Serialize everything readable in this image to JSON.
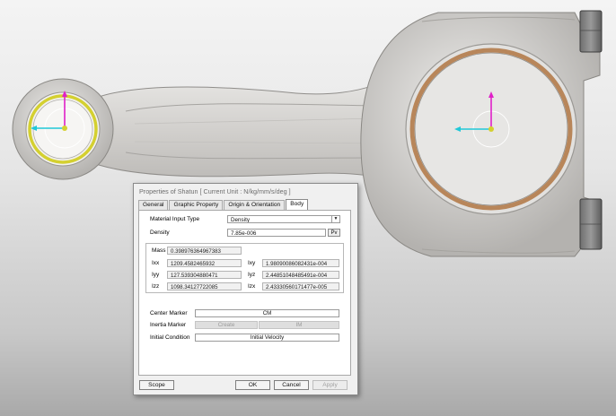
{
  "dialog": {
    "title": "Properties of Shatun [ Current Unit : N/kg/mm/s/deg ]",
    "tabs": [
      {
        "label": "General",
        "active": false
      },
      {
        "label": "Graphic Property",
        "active": false
      },
      {
        "label": "Origin & Orientation",
        "active": false
      },
      {
        "label": "Body",
        "active": true
      }
    ],
    "material_input_type": {
      "label": "Material Input Type",
      "value": "Density"
    },
    "density": {
      "label": "Density",
      "value": "7.85e-006",
      "button": "Pv"
    },
    "mass": {
      "label": "Mass",
      "value": "0.398976364967383"
    },
    "inertia": {
      "ixx": {
        "label": "Ixx",
        "value": "1209.4582465932"
      },
      "ixy": {
        "label": "Ixy",
        "value": "1.98090086082431e-004"
      },
      "iyy": {
        "label": "Iyy",
        "value": "127.539304880471"
      },
      "iyz": {
        "label": "Iyz",
        "value": "2.44851048485491e-004"
      },
      "izz": {
        "label": "Izz",
        "value": "1098.34127722085"
      },
      "izx": {
        "label": "Izx",
        "value": "2.43330560171477e-005"
      }
    },
    "center_marker": {
      "label": "Center Marker",
      "value": "CM"
    },
    "inertia_marker": {
      "label": "Inertia Marker",
      "create": "Create",
      "im": "IM"
    },
    "initial_condition": {
      "label": "Initial Condition",
      "value": "Initial Velocity"
    },
    "buttons": {
      "scope": "Scope",
      "ok": "OK",
      "cancel": "Cancel",
      "apply": "Apply"
    }
  },
  "colors": {
    "rod_body": "#d7d5d2",
    "bearing_ring": "#b8865a",
    "bushing_highlight": "#d4d030",
    "axis_x": "#20c8d8",
    "axis_y": "#e020c8"
  }
}
